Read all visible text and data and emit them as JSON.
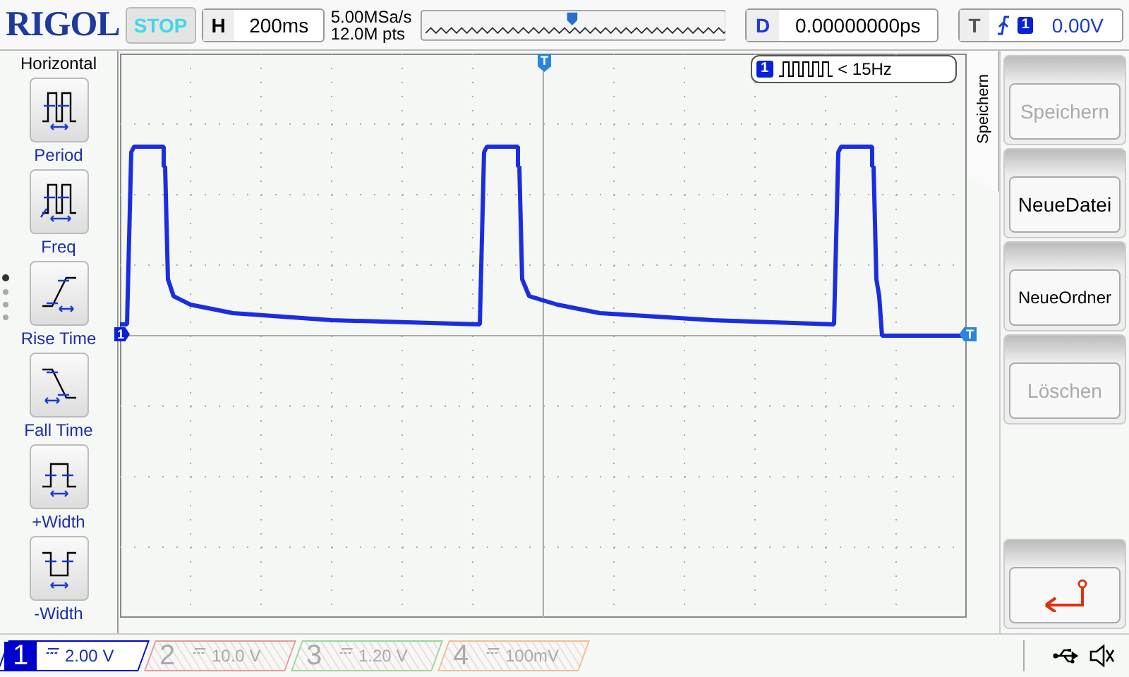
{
  "brand": "RIGOL",
  "run_state": "STOP",
  "timebase": {
    "label": "H",
    "value": "200ms"
  },
  "acquisition": {
    "sample_rate": "5.00MSa/s",
    "memory_depth": "12.0M pts"
  },
  "delay": {
    "label": "D",
    "value": "0.00000000ps"
  },
  "trigger": {
    "label": "T",
    "channel": "1",
    "level": "0.00V"
  },
  "measure_menu": {
    "title": "Horizontal",
    "items": [
      {
        "label": "Period",
        "kind": "period"
      },
      {
        "label": "Freq",
        "kind": "freq"
      },
      {
        "label": "Rise Time",
        "kind": "rise"
      },
      {
        "label": "Fall Time",
        "kind": "fall"
      },
      {
        "label": "+Width",
        "kind": "pwidth"
      },
      {
        "label": "-Width",
        "kind": "nwidth"
      }
    ]
  },
  "screen": {
    "channel_marker": "1",
    "trigger_marker": "T",
    "top_trigger_marker": "T",
    "frequency_counter": {
      "channel": "1",
      "value": "< 15Hz"
    }
  },
  "save_menu": {
    "title": "Speichern",
    "buttons": [
      {
        "label": "Speichern",
        "disabled": true
      },
      {
        "label": "NeueDatei",
        "disabled": false
      },
      {
        "label": "NeueOrdner",
        "disabled": false
      },
      {
        "label": "Löschen",
        "disabled": true
      }
    ]
  },
  "channels": [
    {
      "number": "1",
      "scale": "2.00 V",
      "on": true,
      "color": "#0000cc"
    },
    {
      "number": "2",
      "scale": "10.0 V",
      "on": false,
      "color": "#e89a9a"
    },
    {
      "number": "3",
      "scale": "1.20 V",
      "on": false,
      "color": "#9ad89a"
    },
    {
      "number": "4",
      "scale": "100mV",
      "on": false,
      "color": "#f0c090"
    }
  ]
}
